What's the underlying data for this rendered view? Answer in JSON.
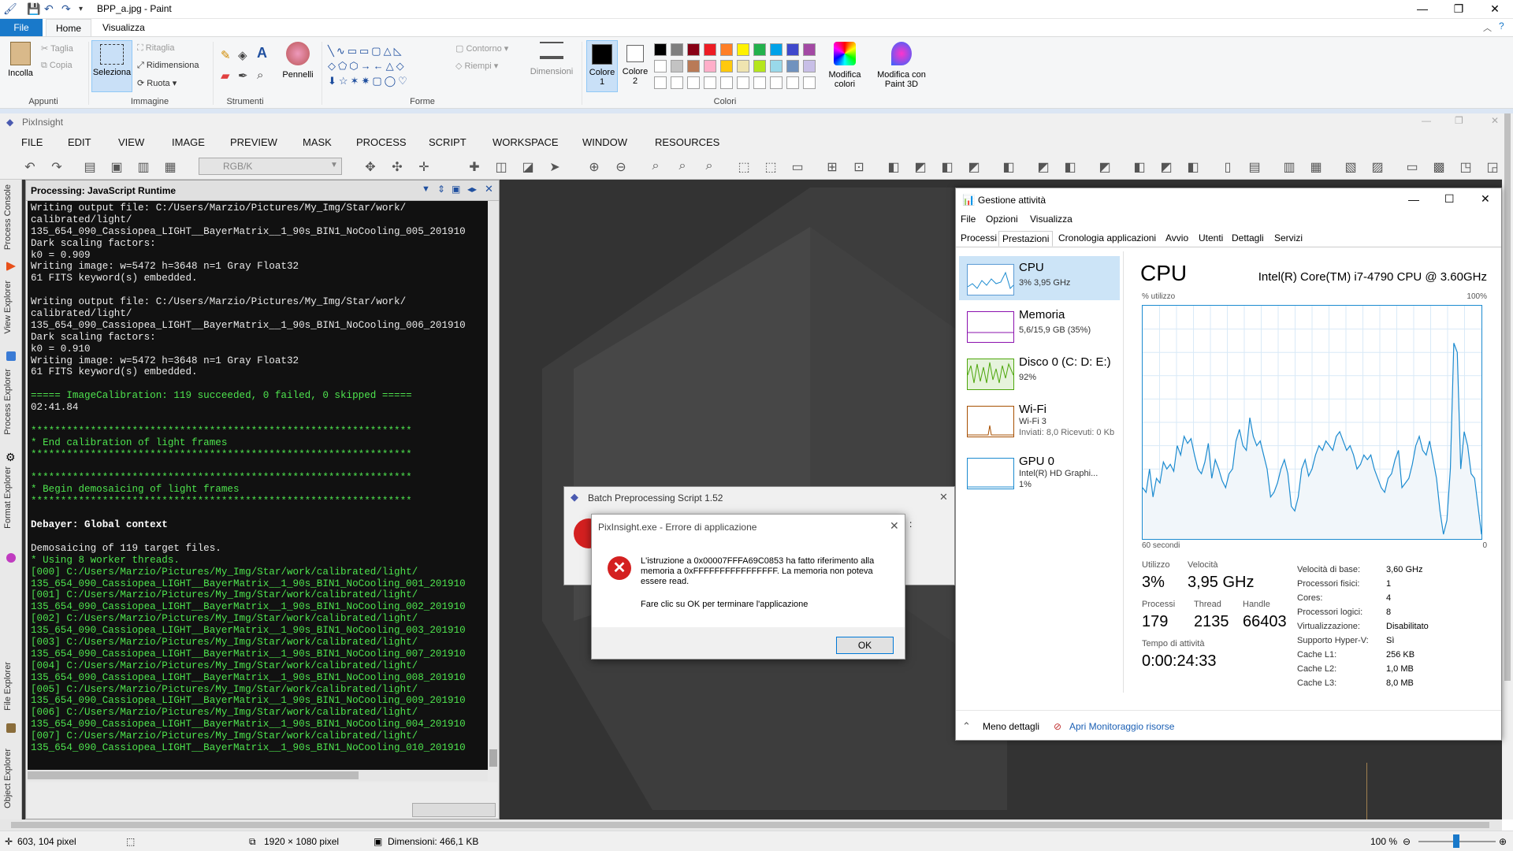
{
  "paint": {
    "title": "BPP_a.jpg - Paint",
    "tabs": {
      "file": "File",
      "home": "Home",
      "view": "Visualizza"
    },
    "clipboard": {
      "paste": "Incolla",
      "cut": "Taglia",
      "copy": "Copia",
      "group": "Appunti"
    },
    "image": {
      "select": "Seleziona",
      "crop": "Ritaglia",
      "resize": "Ridimensiona",
      "rotate": "Ruota",
      "group": "Immagine"
    },
    "tools": {
      "group": "Strumenti"
    },
    "brushes": "Pennelli",
    "shapes": {
      "outline": "Contorno",
      "fill": "Riempi",
      "group": "Forme"
    },
    "size": "Dimensioni",
    "colors": {
      "color1": "Colore 1",
      "color2": "Colore 2",
      "edit": "Modifica colori",
      "paint3d": "Modifica con Paint 3D",
      "group": "Colori",
      "palette_row1": [
        "#000000",
        "#7f7f7f",
        "#880015",
        "#ed1c24",
        "#ff7f27",
        "#fff200",
        "#22b14c",
        "#00a2e8",
        "#3f48cc",
        "#a349a4"
      ],
      "palette_row2": [
        "#ffffff",
        "#c3c3c3",
        "#b97a57",
        "#ffaec9",
        "#ffc90e",
        "#efe4b0",
        "#b5e61d",
        "#99d9ea",
        "#7092be",
        "#c8bfe7"
      ]
    },
    "status": {
      "cursor": "603, 104 pixel",
      "size": "1920 × 1080 pixel",
      "filesize": "Dimensioni: 466,1 KB",
      "zoom": "100 %"
    }
  },
  "pixinsight": {
    "title": "PixInsight",
    "menu": [
      "FILE",
      "EDIT",
      "VIEW",
      "IMAGE",
      "PREVIEW",
      "MASK",
      "PROCESS",
      "SCRIPT",
      "WORKSPACE",
      "WINDOW",
      "RESOURCES"
    ],
    "color_space": "RGB/K",
    "sidebar_tabs": [
      "Process Console",
      "View Explorer",
      "Process Explorer",
      "Format Explorer",
      "File Explorer",
      "Object Explorer"
    ],
    "console": {
      "title": "Processing: JavaScript Runtime",
      "lines": [
        {
          "t": "Writing output file: C:/Users/Marzio/Pictures/My_Img/Star/work/",
          "c": "w"
        },
        {
          "t": "calibrated/light/",
          "c": "w"
        },
        {
          "t": "135_654_090_Cassiopea_LIGHT__BayerMatrix__1_90s_BIN1_NoCooling_005_201910",
          "c": "w"
        },
        {
          "t": "Dark scaling factors:",
          "c": "w"
        },
        {
          "t": "k0 = 0.909",
          "c": "w"
        },
        {
          "t": "Writing image: w=5472 h=3648 n=1 Gray Float32",
          "c": "w"
        },
        {
          "t": "61 FITS keyword(s) embedded.",
          "c": "w"
        },
        {
          "t": "",
          "c": "w"
        },
        {
          "t": "Writing output file: C:/Users/Marzio/Pictures/My_Img/Star/work/",
          "c": "w"
        },
        {
          "t": "calibrated/light/",
          "c": "w"
        },
        {
          "t": "135_654_090_Cassiopea_LIGHT__BayerMatrix__1_90s_BIN1_NoCooling_006_201910",
          "c": "w"
        },
        {
          "t": "Dark scaling factors:",
          "c": "w"
        },
        {
          "t": "k0 = 0.910",
          "c": "w"
        },
        {
          "t": "Writing image: w=5472 h=3648 n=1 Gray Float32",
          "c": "w"
        },
        {
          "t": "61 FITS keyword(s) embedded.",
          "c": "w"
        },
        {
          "t": "",
          "c": "w"
        },
        {
          "t": "===== ImageCalibration: 119 succeeded, 0 failed, 0 skipped =====",
          "c": "g"
        },
        {
          "t": "02:41.84",
          "c": "w"
        },
        {
          "t": "",
          "c": "w"
        },
        {
          "t": "****************************************************************",
          "c": "g"
        },
        {
          "t": "* End calibration of light frames",
          "c": "g"
        },
        {
          "t": "****************************************************************",
          "c": "g"
        },
        {
          "t": "",
          "c": "w"
        },
        {
          "t": "****************************************************************",
          "c": "g"
        },
        {
          "t": "* Begin demosaicing of light frames",
          "c": "g"
        },
        {
          "t": "****************************************************************",
          "c": "g"
        },
        {
          "t": "",
          "c": "w"
        },
        {
          "t": "Debayer: Global context",
          "c": "b"
        },
        {
          "t": "",
          "c": "w"
        },
        {
          "t": "Demosaicing of 119 target files.",
          "c": "w"
        },
        {
          "t": "* Using 8 worker threads.",
          "c": "g"
        },
        {
          "t": "[000] C:/Users/Marzio/Pictures/My_Img/Star/work/calibrated/light/",
          "c": "g"
        },
        {
          "t": "135_654_090_Cassiopea_LIGHT__BayerMatrix__1_90s_BIN1_NoCooling_001_201910",
          "c": "g"
        },
        {
          "t": "[001] C:/Users/Marzio/Pictures/My_Img/Star/work/calibrated/light/",
          "c": "g"
        },
        {
          "t": "135_654_090_Cassiopea_LIGHT__BayerMatrix__1_90s_BIN1_NoCooling_002_201910",
          "c": "g"
        },
        {
          "t": "[002] C:/Users/Marzio/Pictures/My_Img/Star/work/calibrated/light/",
          "c": "g"
        },
        {
          "t": "135_654_090_Cassiopea_LIGHT__BayerMatrix__1_90s_BIN1_NoCooling_003_201910",
          "c": "g"
        },
        {
          "t": "[003] C:/Users/Marzio/Pictures/My_Img/Star/work/calibrated/light/",
          "c": "g"
        },
        {
          "t": "135_654_090_Cassiopea_LIGHT__BayerMatrix__1_90s_BIN1_NoCooling_007_201910",
          "c": "g"
        },
        {
          "t": "[004] C:/Users/Marzio/Pictures/My_Img/Star/work/calibrated/light/",
          "c": "g"
        },
        {
          "t": "135_654_090_Cassiopea_LIGHT__BayerMatrix__1_90s_BIN1_NoCooling_008_201910",
          "c": "g"
        },
        {
          "t": "[005] C:/Users/Marzio/Pictures/My_Img/Star/work/calibrated/light/",
          "c": "g"
        },
        {
          "t": "135_654_090_Cassiopea_LIGHT__BayerMatrix__1_90s_BIN1_NoCooling_009_201910",
          "c": "g"
        },
        {
          "t": "[006] C:/Users/Marzio/Pictures/My_Img/Star/work/calibrated/light/",
          "c": "g"
        },
        {
          "t": "135_654_090_Cassiopea_LIGHT__BayerMatrix__1_90s_BIN1_NoCooling_004_201910",
          "c": "g"
        },
        {
          "t": "[007] C:/Users/Marzio/Pictures/My_Img/Star/work/calibrated/light/",
          "c": "g"
        },
        {
          "t": "135_654_090_Cassiopea_LIGHT__BayerMatrix__1_90s_BIN1_NoCooling_010_201910",
          "c": "g"
        }
      ]
    }
  },
  "task_manager": {
    "title": "Gestione attività",
    "menu": [
      "File",
      "Opzioni",
      "Visualizza"
    ],
    "tabs": [
      "Processi",
      "Prestazioni",
      "Cronologia applicazioni",
      "Avvio",
      "Utenti",
      "Dettagli",
      "Servizi"
    ],
    "resources": [
      {
        "name": "CPU",
        "sub1": "3% 3,95 GHz",
        "sub2": ""
      },
      {
        "name": "Memoria",
        "sub1": "5,6/15,9 GB (35%)",
        "sub2": ""
      },
      {
        "name": "Disco 0 (C: D: E:)",
        "sub1": "92%",
        "sub2": ""
      },
      {
        "name": "Wi-Fi",
        "sub1": "Wi-Fi 3",
        "sub2": "Inviati: 8,0 Ricevuti: 0 Kb"
      },
      {
        "name": "GPU 0",
        "sub1": "Intel(R) HD Graphi...",
        "sub2": "1%"
      }
    ],
    "cpu": {
      "title": "CPU",
      "model": "Intel(R) Core(TM) i7-4790 CPU @ 3.60GHz",
      "util_label": "% utilizzo",
      "max_label": "100%",
      "time_label": "60 secondi",
      "min_label": "0",
      "utilization_series": [
        22,
        20,
        30,
        18,
        26,
        24,
        33,
        30,
        32,
        29,
        40,
        36,
        44,
        41,
        43,
        36,
        30,
        28,
        33,
        41,
        26,
        34,
        30,
        25,
        22,
        28,
        30,
        42,
        47,
        40,
        38,
        52,
        44,
        40,
        42,
        36,
        30,
        18,
        20,
        24,
        30,
        34,
        28,
        14,
        12,
        18,
        30,
        34,
        27,
        30,
        36,
        40,
        38,
        42,
        40,
        38,
        44,
        46,
        42,
        38,
        40,
        36,
        30,
        32,
        36,
        34,
        36,
        30,
        26,
        22,
        20,
        26,
        28,
        34,
        38,
        22,
        24,
        26,
        32,
        40,
        44,
        38,
        36,
        42,
        34,
        26,
        12,
        2,
        8,
        30,
        84,
        80,
        30,
        46,
        40,
        28,
        26,
        14,
        2
      ],
      "stats": {
        "util_label": "Utilizzo",
        "util": "3%",
        "speed_label": "Velocità",
        "speed": "3,95 GHz",
        "proc_label": "Processi",
        "proc": "179",
        "thread_label": "Thread",
        "thread": "2135",
        "handle_label": "Handle",
        "handle": "66403",
        "uptime_label": "Tempo di attività",
        "uptime": "0:00:24:33"
      },
      "specs": [
        {
          "k": "Velocità di base:",
          "v": "3,60 GHz"
        },
        {
          "k": "Processori fisici:",
          "v": "1"
        },
        {
          "k": "Cores:",
          "v": "4"
        },
        {
          "k": "Processori logici:",
          "v": "8"
        },
        {
          "k": "Virtualizzazione:",
          "v": "Disabilitato"
        },
        {
          "k": "Supporto Hyper-V:",
          "v": "Sì"
        },
        {
          "k": "Cache L1:",
          "v": "256 KB"
        },
        {
          "k": "Cache L2:",
          "v": "1,0 MB"
        },
        {
          "k": "Cache L3:",
          "v": "8,0 MB"
        }
      ]
    },
    "less_details": "Meno dettagli",
    "resource_monitor": "Apri Monitoraggio risorse"
  },
  "batch_dialog": {
    "title": "Batch Preprocessing Script 1.52"
  },
  "error_dialog": {
    "title": "PixInsight.exe - Errore di applicazione",
    "message": "L'istruzione a 0x00007FFFA69C0853 ha fatto riferimento alla memoria a 0xFFFFFFFFFFFFFFFF. La memoria non poteva essere read.",
    "instruction": "Fare clic su OK per terminare l'applicazione",
    "ok": "OK"
  }
}
